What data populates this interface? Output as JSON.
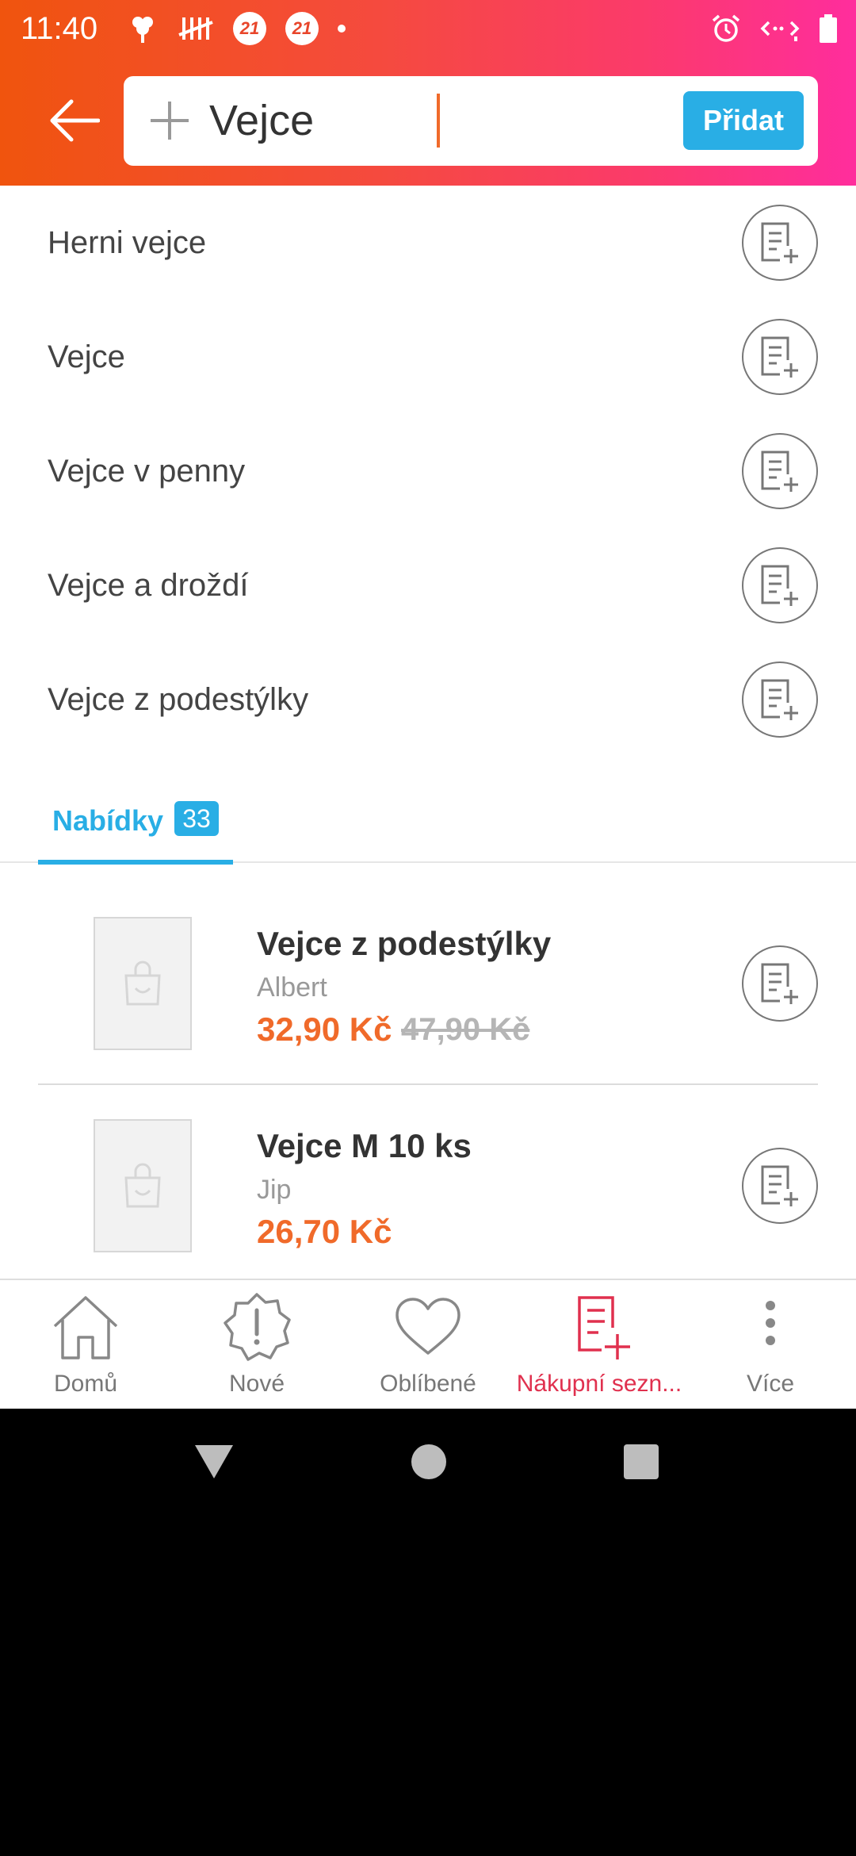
{
  "status_bar": {
    "time": "11:40",
    "badge_a": "21",
    "badge_b": "21"
  },
  "header": {
    "search_value": "Vejce",
    "add_label": "Přidat"
  },
  "suggestions": [
    {
      "label": "Herni vejce"
    },
    {
      "label": "Vejce"
    },
    {
      "label": "Vejce v penny"
    },
    {
      "label": "Vejce a droždí"
    },
    {
      "label": "Vejce z podestýlky"
    }
  ],
  "tabs": {
    "offers_label": "Nabídky",
    "offers_count": "33"
  },
  "offers": [
    {
      "title": "Vejce z podestýlky",
      "shop": "Albert",
      "price": "32,90 Kč",
      "old_price": "47,90 Kč"
    },
    {
      "title": "Vejce M 10 ks",
      "shop": "Jip",
      "price": "26,70 Kč"
    }
  ],
  "bottom_nav": [
    {
      "label": "Domů",
      "icon": "home-icon"
    },
    {
      "label": "Nové",
      "icon": "new-badge-icon"
    },
    {
      "label": "Oblíbené",
      "icon": "heart-icon"
    },
    {
      "label": "Nákupní sezn...",
      "icon": "shopping-list-icon"
    },
    {
      "label": "Více",
      "icon": "more-icon"
    }
  ],
  "colors": {
    "accent": "#29aee5",
    "price": "#f06a2a",
    "active_nav": "#e0304e"
  }
}
